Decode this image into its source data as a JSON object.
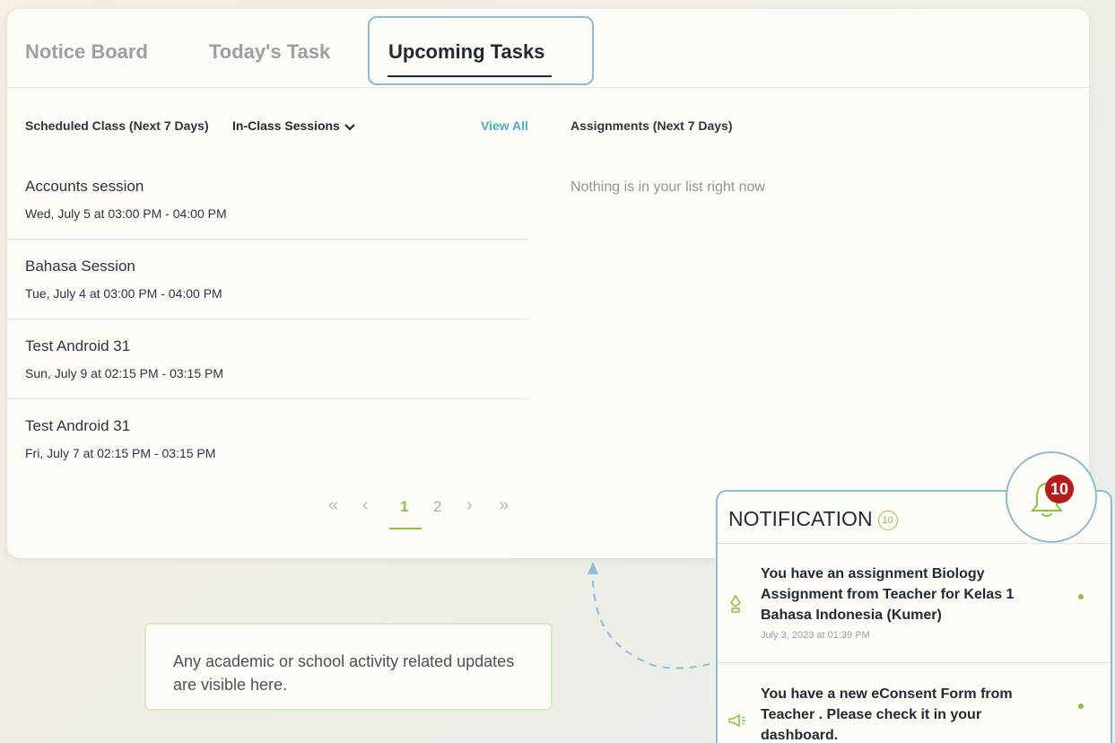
{
  "tabs": {
    "notice_board": "Notice Board",
    "todays_task": "Today's Task",
    "upcoming_tasks": "Upcoming Tasks"
  },
  "scheduled": {
    "title": "Scheduled Class (Next 7 Days)",
    "filter": "In-Class Sessions",
    "view_all": "View All",
    "items": [
      {
        "name": "Accounts session",
        "time": "Wed, July 5 at 03:00 PM - 04:00 PM"
      },
      {
        "name": "Bahasa Session",
        "time": "Tue, July 4 at 03:00 PM - 04:00 PM"
      },
      {
        "name": "Test Android 31",
        "time": "Sun, July 9 at 02:15 PM - 03:15 PM"
      },
      {
        "name": "Test Android 31",
        "time": "Fri, July 7 at 02:15 PM - 03:15 PM"
      }
    ]
  },
  "pagination": {
    "first": "«",
    "prev": "‹",
    "pages": [
      "1",
      "2"
    ],
    "current": "1",
    "next": "›",
    "last": "»"
  },
  "assignments": {
    "title": "Assignments (Next 7 Days)",
    "empty_text": "Nothing is in your list right now"
  },
  "hint": {
    "text": "Any academic or school activity related updates are visible here."
  },
  "notification": {
    "title": "NOTIFICATION",
    "count": "10",
    "badge": "10",
    "items": [
      {
        "icon": "pen-nib-icon",
        "text": "You have an assignment Biology Assignment from Teacher for Kelas 1 Bahasa Indonesia (Kumer)",
        "date": "July 3, 2023 at 01:39 PM"
      },
      {
        "icon": "megaphone-icon",
        "text": "You have a new eConsent Form from Teacher . Please check it in your dashboard.",
        "date": ""
      }
    ]
  },
  "colors": {
    "accent_green": "#8bc34a",
    "highlight_blue": "#8fbcd4",
    "link_teal": "#4aaec3",
    "badge_red": "#b71c1c"
  }
}
